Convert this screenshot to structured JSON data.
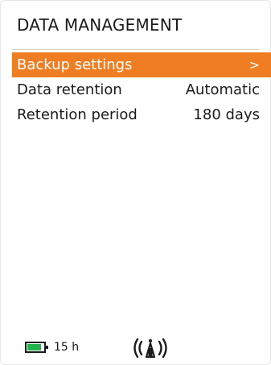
{
  "screen": {
    "title": "DATA MANAGEMENT"
  },
  "menu": {
    "items": [
      {
        "label": "Backup settings",
        "value": ">",
        "selected": true
      },
      {
        "label": "Data retention",
        "value": "Automatic",
        "selected": false
      },
      {
        "label": "Retention period",
        "value": "180 days",
        "selected": false
      }
    ]
  },
  "status": {
    "battery_icon": "battery-icon",
    "battery_level_fraction": 0.85,
    "battery_time": "15 h",
    "signal_icon": "wireless-signal-icon"
  },
  "colors": {
    "accent": "#ef7d22",
    "battery_fill": "#22b24c",
    "text": "#1a1a1a",
    "background": "#ffffff"
  }
}
